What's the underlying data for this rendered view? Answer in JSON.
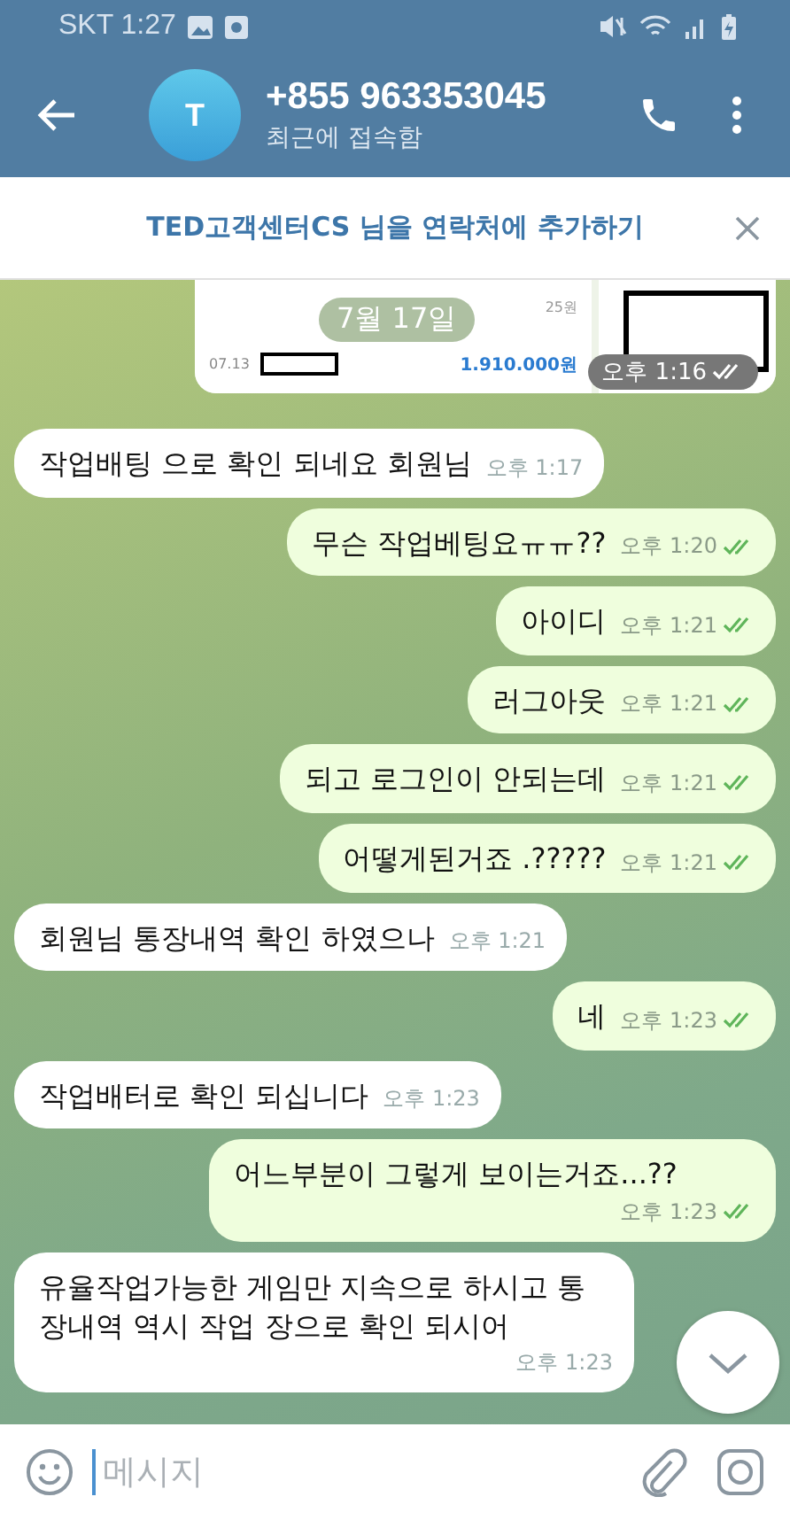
{
  "status_bar": {
    "carrier": "SKT",
    "time": "1:27"
  },
  "header": {
    "avatar_letter": "T",
    "title": "+855 963353045",
    "subtitle": "최근에 접속함"
  },
  "banner": {
    "text": "TED고객센터CS 님을 연락처에 추가하기"
  },
  "messages": [
    {
      "kind": "image",
      "outgoing": true,
      "date_pill": "7월 17일",
      "time": "오후 1:16",
      "read": true,
      "shot_texts": [
        "25원",
        "07.13",
        "1.910.000원"
      ]
    },
    {
      "kind": "text",
      "outgoing": false,
      "text": "작업배팅 으로 확인 되네요 회원님",
      "time": "오후 1:17"
    },
    {
      "kind": "text",
      "outgoing": true,
      "text": "무슨 작업베팅요ㅠㅠ??",
      "time": "오후 1:20",
      "read": true
    },
    {
      "kind": "text",
      "outgoing": true,
      "text": "아이디",
      "time": "오후 1:21",
      "read": true
    },
    {
      "kind": "text",
      "outgoing": true,
      "text": "러그아웃",
      "time": "오후 1:21",
      "read": true
    },
    {
      "kind": "text",
      "outgoing": true,
      "text": "되고 로그인이 안되는데",
      "time": "오후 1:21",
      "read": true
    },
    {
      "kind": "text",
      "outgoing": true,
      "text": "어떻게된거죠 .?????",
      "time": "오후 1:21",
      "read": true
    },
    {
      "kind": "text",
      "outgoing": false,
      "text": "회원님 통장내역 확인 하였으나",
      "time": "오후 1:21"
    },
    {
      "kind": "text",
      "outgoing": true,
      "text": "네",
      "time": "오후 1:23",
      "read": true
    },
    {
      "kind": "text",
      "outgoing": false,
      "text": "작업배터로 확인 되십니다",
      "time": "오후 1:23"
    },
    {
      "kind": "text",
      "outgoing": true,
      "text": "어느부분이 그렇게 보이는거죠...??",
      "time": "오후 1:23",
      "read": true
    },
    {
      "kind": "text",
      "outgoing": false,
      "text": "유율작업가능한 게임만 지속으로 하시고 통장내역 역시 작업 장으로 확인 되시어",
      "time": "오후 1:23"
    }
  ],
  "composer": {
    "placeholder": "메시지"
  }
}
